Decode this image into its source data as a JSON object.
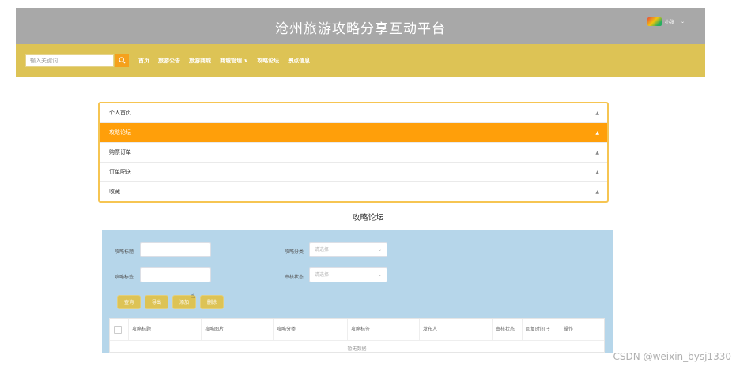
{
  "header": {
    "title": "沧州旅游攻略分享互动平台",
    "user_name": "小张",
    "caret": "⌄"
  },
  "navbar": {
    "search_placeholder": "输入关键词",
    "search_icon": "search-icon",
    "items": [
      "首页",
      "旅游公告",
      "旅游商城",
      "商城管理 ∨",
      "攻略论坛",
      "景点信息"
    ]
  },
  "menu": {
    "items": [
      "个人首页",
      "攻略论坛",
      "购票订单",
      "订单配送",
      "收藏"
    ],
    "active_index": 1,
    "arrow": "▲"
  },
  "section_title": "攻略论坛",
  "filters": {
    "title_label": "攻略标题",
    "category_label": "攻略分类",
    "tag_label": "攻略标签",
    "status_label": "审核状态",
    "category_placeholder": "请选择",
    "status_placeholder": "请选择",
    "select_caret": "⌄"
  },
  "buttons": [
    "查询",
    "导出",
    "添加",
    "删除"
  ],
  "table": {
    "columns": [
      "攻略标题",
      "攻略图片",
      "攻略分类",
      "攻略标签",
      "发布人",
      "审核状态",
      "回复时间 ÷",
      "操作"
    ],
    "empty_text": "暂无数据"
  },
  "watermark": "CSDN @weixin_bysj1330",
  "colors": {
    "header_bg": "#a8a8a8",
    "navbar_bg": "#ddc355",
    "accent_orange": "#ff9f0a",
    "panel_bg": "#b6d6ea"
  }
}
